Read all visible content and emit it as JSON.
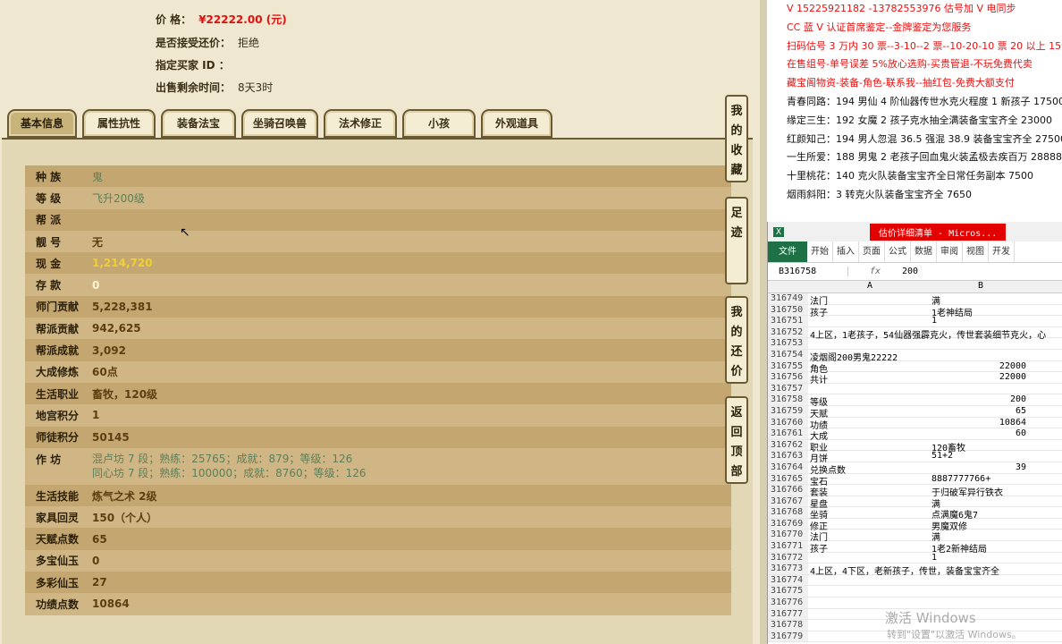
{
  "header": {
    "price_label": "价 格：",
    "price_value": "¥22222.00 (元)",
    "bargain_label": "是否接受还价：",
    "bargain_value": "拒绝",
    "buyer_label": "指定买家 ID ：",
    "buyer_value": "",
    "time_label": "出售剩余时间：",
    "time_value": "8天3时"
  },
  "tabs": [
    "基本信息",
    "属性抗性",
    "装备法宝",
    "坐骑召唤兽",
    "法术修正",
    "小孩",
    "外观道具"
  ],
  "rows": [
    {
      "label": "种 族",
      "value": "鬼",
      "style": "green"
    },
    {
      "label": "等 级",
      "value": "飞升200级",
      "style": "green"
    },
    {
      "label": "帮 派",
      "value": "",
      "style": ""
    },
    {
      "label": "靓 号",
      "value": "无",
      "style": ""
    },
    {
      "label": "现 金",
      "value": "1,214,720",
      "style": "gold"
    },
    {
      "label": "存 款",
      "value": "0",
      "style": "white"
    },
    {
      "label": "师门贡献",
      "value": "5,228,381",
      "style": ""
    },
    {
      "label": "帮派贡献",
      "value": "942,625",
      "style": ""
    },
    {
      "label": "帮派成就",
      "value": "3,092",
      "style": ""
    },
    {
      "label": "大成修炼",
      "value": "60点",
      "style": ""
    },
    {
      "label": "生活职业",
      "value": "畜牧，120级",
      "style": ""
    },
    {
      "label": "地宫积分",
      "value": "1",
      "style": ""
    },
    {
      "label": "师徒积分",
      "value": "50145",
      "style": ""
    },
    {
      "label": "作 坊",
      "value": "混卢坊 7 段；熟练：25765；成就：879；等级：126",
      "value2": "同心坊 7 段；熟练：100000；成就：8760；等级：126",
      "style": "tall"
    },
    {
      "label": "生活技能",
      "value": "炼气之术 2级",
      "style": ""
    },
    {
      "label": "家具回灵",
      "value": "150（个人）",
      "style": ""
    },
    {
      "label": "天赋点数",
      "value": "65",
      "style": ""
    },
    {
      "label": "多宝仙玉",
      "value": "0",
      "style": ""
    },
    {
      "label": "多彩仙玉",
      "value": "27",
      "style": ""
    },
    {
      "label": "功绩点数",
      "value": "10864",
      "style": ""
    }
  ],
  "side_buttons": [
    "我的收藏",
    "足迹",
    "我的还价",
    "返回顶部"
  ],
  "notes": [
    {
      "t": "V 15225921182 -13782553976 估号加 V 电同步",
      "c": "red"
    },
    {
      "t": "CC 蓝 V 认证首席鉴定--金牌鉴定为您服务",
      "c": "red"
    },
    {
      "t": "扫码估号 3 万内 30 票--3-10--2 票--10-20-10 票 20 以上 150",
      "c": "red"
    },
    {
      "t": "在售组号-单号误差 5%放心选购-买贵管退-不玩免费代卖",
      "c": "red"
    },
    {
      "t": "藏宝阁物资-装备-角色-联系我--抽红包-免费大额支付",
      "c": "red"
    },
    {
      "t": "青春同路：194 男仙 4 阶仙器传世水克火程度 1 新孩子 17500",
      "c": "blk"
    },
    {
      "t": "缘定三生：192 女魔 2 孩子克水抽全满装备宝宝齐全 23000",
      "c": "blk"
    },
    {
      "t": "红颜知己：194 男人忽混 36.5 强混 38.9 装备宝宝齐全 27500",
      "c": "blk"
    },
    {
      "t": "一生所爱：188 男鬼 2 老孩子回血鬼火装孟极去疾百万 28888",
      "c": "blk"
    },
    {
      "t": "十里桃花：140 克火队装备宝宝齐全日常任务副本 7500",
      "c": "blk"
    },
    {
      "t": "烟雨斜阳：3 转克火队装备宝宝齐全 7650",
      "c": "blk"
    }
  ],
  "excel": {
    "title": "估价详细清单 - Micros...",
    "ribbon": [
      "文件",
      "开始",
      "插入",
      "页面",
      "公式",
      "数据",
      "审阅",
      "视图",
      "开发"
    ],
    "namebox": "B316758",
    "fx": "fx",
    "formula": "200",
    "cols": [
      "A",
      "B"
    ],
    "rows": [
      [
        "316749",
        "法门",
        "满",
        ""
      ],
      [
        "316750",
        "孩子",
        "1老神结局",
        ""
      ],
      [
        "316751",
        "",
        "1",
        ""
      ],
      [
        "316752",
        "4上区，1老孩子，54仙器强霹克火，传世套装细节克火，心",
        "",
        ""
      ],
      [
        "316753",
        "",
        "",
        ""
      ],
      [
        "316754",
        "凌烟阁200男鬼22222",
        "",
        ""
      ],
      [
        "316755",
        "角色",
        "22000",
        "n"
      ],
      [
        "316756",
        "共计",
        "22000",
        "n"
      ],
      [
        "316757",
        "",
        "",
        ""
      ],
      [
        "316758",
        "等级",
        "200",
        "n"
      ],
      [
        "316759",
        "天赋",
        "65",
        "n"
      ],
      [
        "316760",
        "功绩",
        "10864",
        "n"
      ],
      [
        "316761",
        "大成",
        "60",
        "n"
      ],
      [
        "316762",
        "职业",
        "120畜牧",
        ""
      ],
      [
        "316763",
        "月饼",
        "51+2",
        ""
      ],
      [
        "316764",
        "兑换点数",
        "39",
        "n"
      ],
      [
        "316765",
        "宝石",
        "8887777766+",
        ""
      ],
      [
        "316766",
        "套装",
        "于归破军异行铁衣",
        ""
      ],
      [
        "316767",
        "星盘",
        "满",
        ""
      ],
      [
        "316768",
        "坐骑",
        "点满魔6鬼7",
        ""
      ],
      [
        "316769",
        "修正",
        "男魔双修",
        ""
      ],
      [
        "316770",
        "法门",
        "满",
        ""
      ],
      [
        "316771",
        "孩子",
        "1老2新神结局",
        ""
      ],
      [
        "316772",
        "",
        "1",
        ""
      ],
      [
        "316773",
        "4上区，4下区，老新孩子，传世，装备宝宝齐全",
        "",
        ""
      ],
      [
        "316774",
        "",
        "",
        ""
      ],
      [
        "316775",
        "",
        "",
        ""
      ],
      [
        "316776",
        "",
        "",
        ""
      ],
      [
        "316777",
        "",
        "",
        ""
      ],
      [
        "316778",
        "",
        "",
        ""
      ],
      [
        "316779",
        "",
        "",
        ""
      ]
    ]
  },
  "watermark": "激活 Windows",
  "watermark2": "转到\"设置\"以激活 Windows。"
}
